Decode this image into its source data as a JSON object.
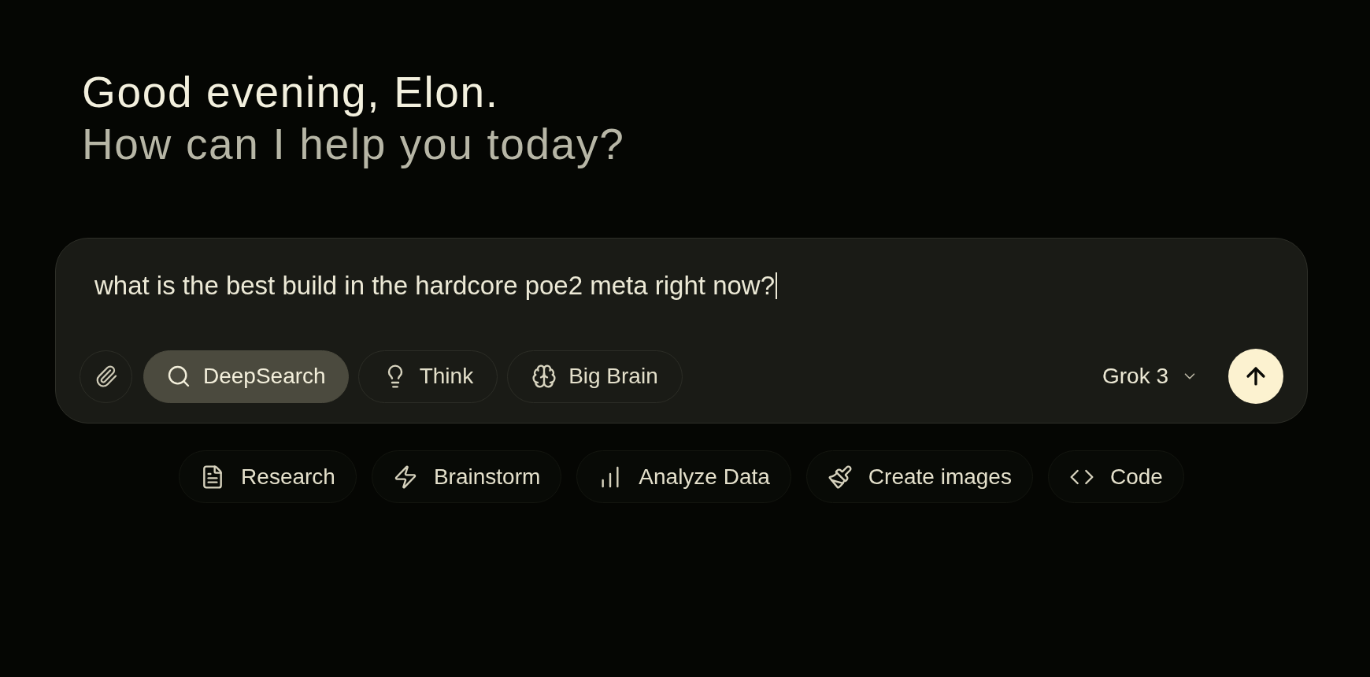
{
  "greeting": {
    "title": "Good evening, Elon.",
    "subtitle": "How can I help you today?"
  },
  "composer": {
    "value": "what is the best build in the hardcore poe2 meta right now?",
    "focused": true,
    "modes": [
      {
        "label": "DeepSearch",
        "selected": true
      },
      {
        "label": "Think",
        "selected": false
      },
      {
        "label": "Big Brain",
        "selected": false
      }
    ],
    "model": "Grok 3"
  },
  "suggestions": [
    "Research",
    "Brainstorm",
    "Analyze Data",
    "Create images",
    "Code"
  ]
}
